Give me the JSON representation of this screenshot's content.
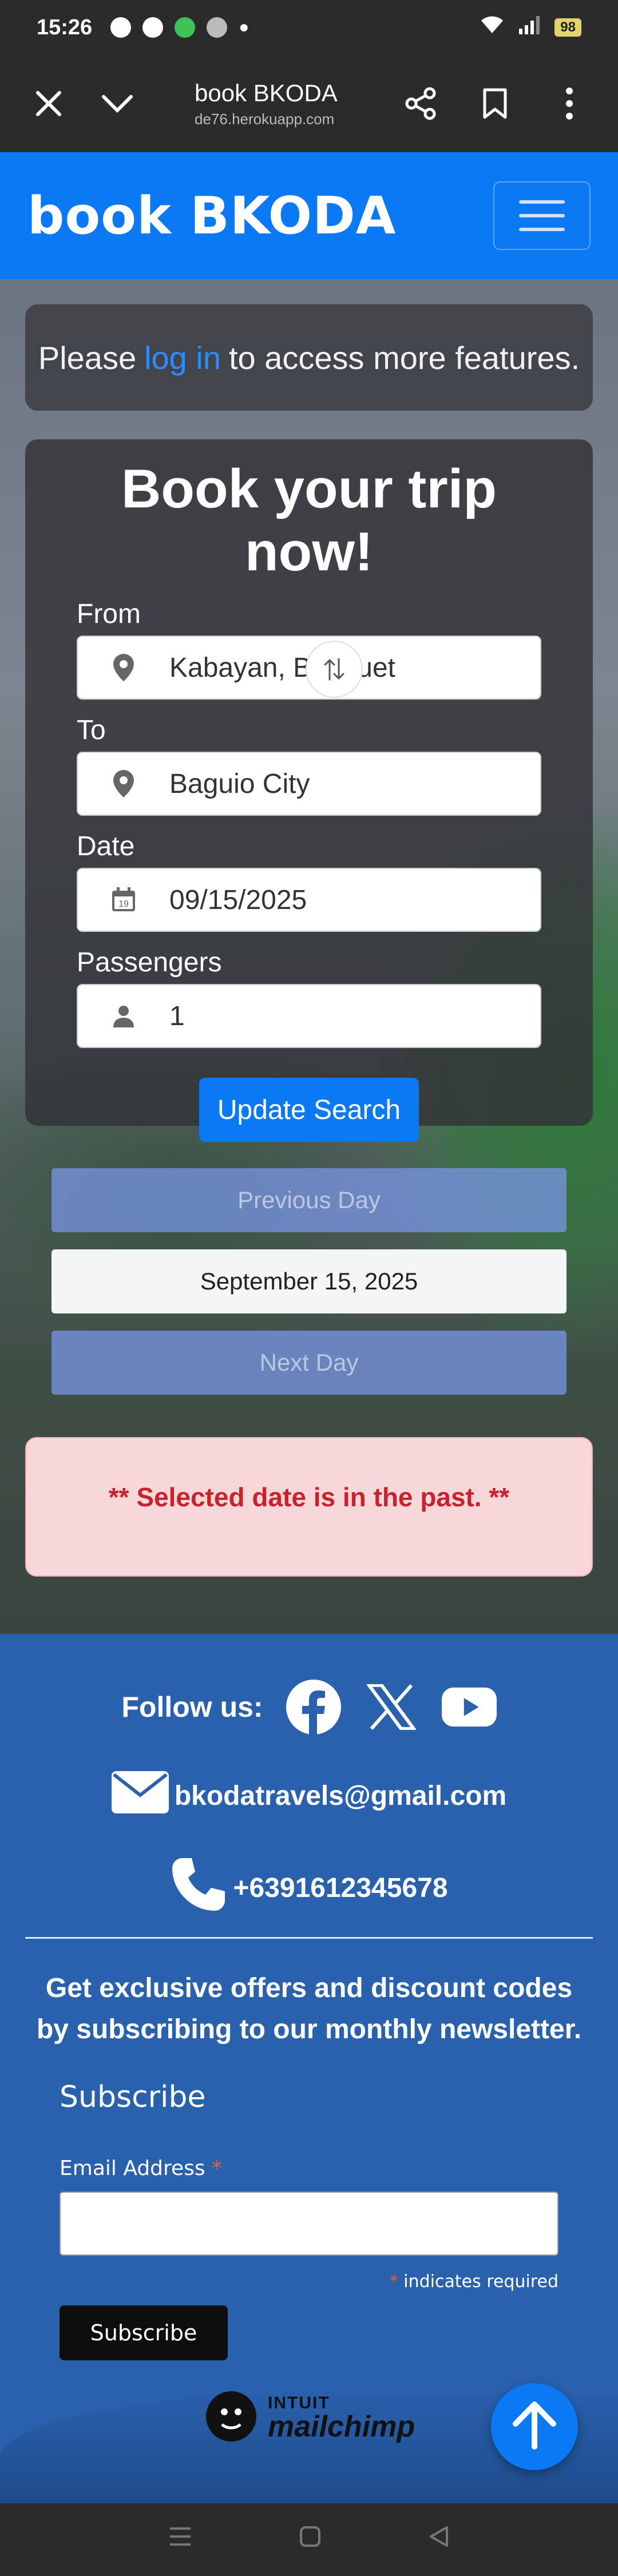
{
  "status_bar": {
    "time": "15:26",
    "battery": "98"
  },
  "browser": {
    "title": "book BKODA",
    "url": "de76.herokuapp.com"
  },
  "navbar": {
    "brand": "book BKODA"
  },
  "login_notice": {
    "before": "Please",
    "link": "log in",
    "after": "to access more features."
  },
  "booking": {
    "heading": "Book your trip now!",
    "from_label": "From",
    "from_value": "Kabayan, Benguet",
    "to_label": "To",
    "to_value": "Baguio City",
    "date_label": "Date",
    "date_value": "09/15/2025",
    "date_icon_day": "19",
    "passengers_label": "Passengers",
    "passengers_value": "1",
    "submit_label": "Update Search"
  },
  "day_nav": {
    "previous": "Previous Day",
    "current": "September 15, 2025",
    "next": "Next Day"
  },
  "alert": {
    "message": "** Selected date is in the past. **"
  },
  "footer": {
    "follow_label": "Follow us:",
    "email": "bkodatravels@gmail.com",
    "phone": "+6391612345678",
    "newsletter": "Get exclusive offers and discount codes by subscribing to our monthly newsletter.",
    "subscribe_heading": "Subscribe",
    "email_label": "Email Address",
    "required_mark": "*",
    "required_note": "indicates required",
    "subscribe_button": "Subscribe",
    "mailchimp_small": "INTUIT",
    "mailchimp_big": "mailchimp"
  },
  "colors": {
    "primary": "#0b78f4",
    "footer": "#2a61ad",
    "alert_bg": "#f8d7da",
    "alert_text": "#c8232c"
  },
  "icons": [
    "close-icon",
    "chevron-down-icon",
    "share-icon",
    "bookmark-icon",
    "more-vert-icon",
    "map-marker-icon",
    "swap-icon",
    "calendar-icon",
    "user-icon",
    "facebook-icon",
    "x-icon",
    "youtube-icon",
    "envelope-icon",
    "phone-icon",
    "arrow-up-icon"
  ]
}
